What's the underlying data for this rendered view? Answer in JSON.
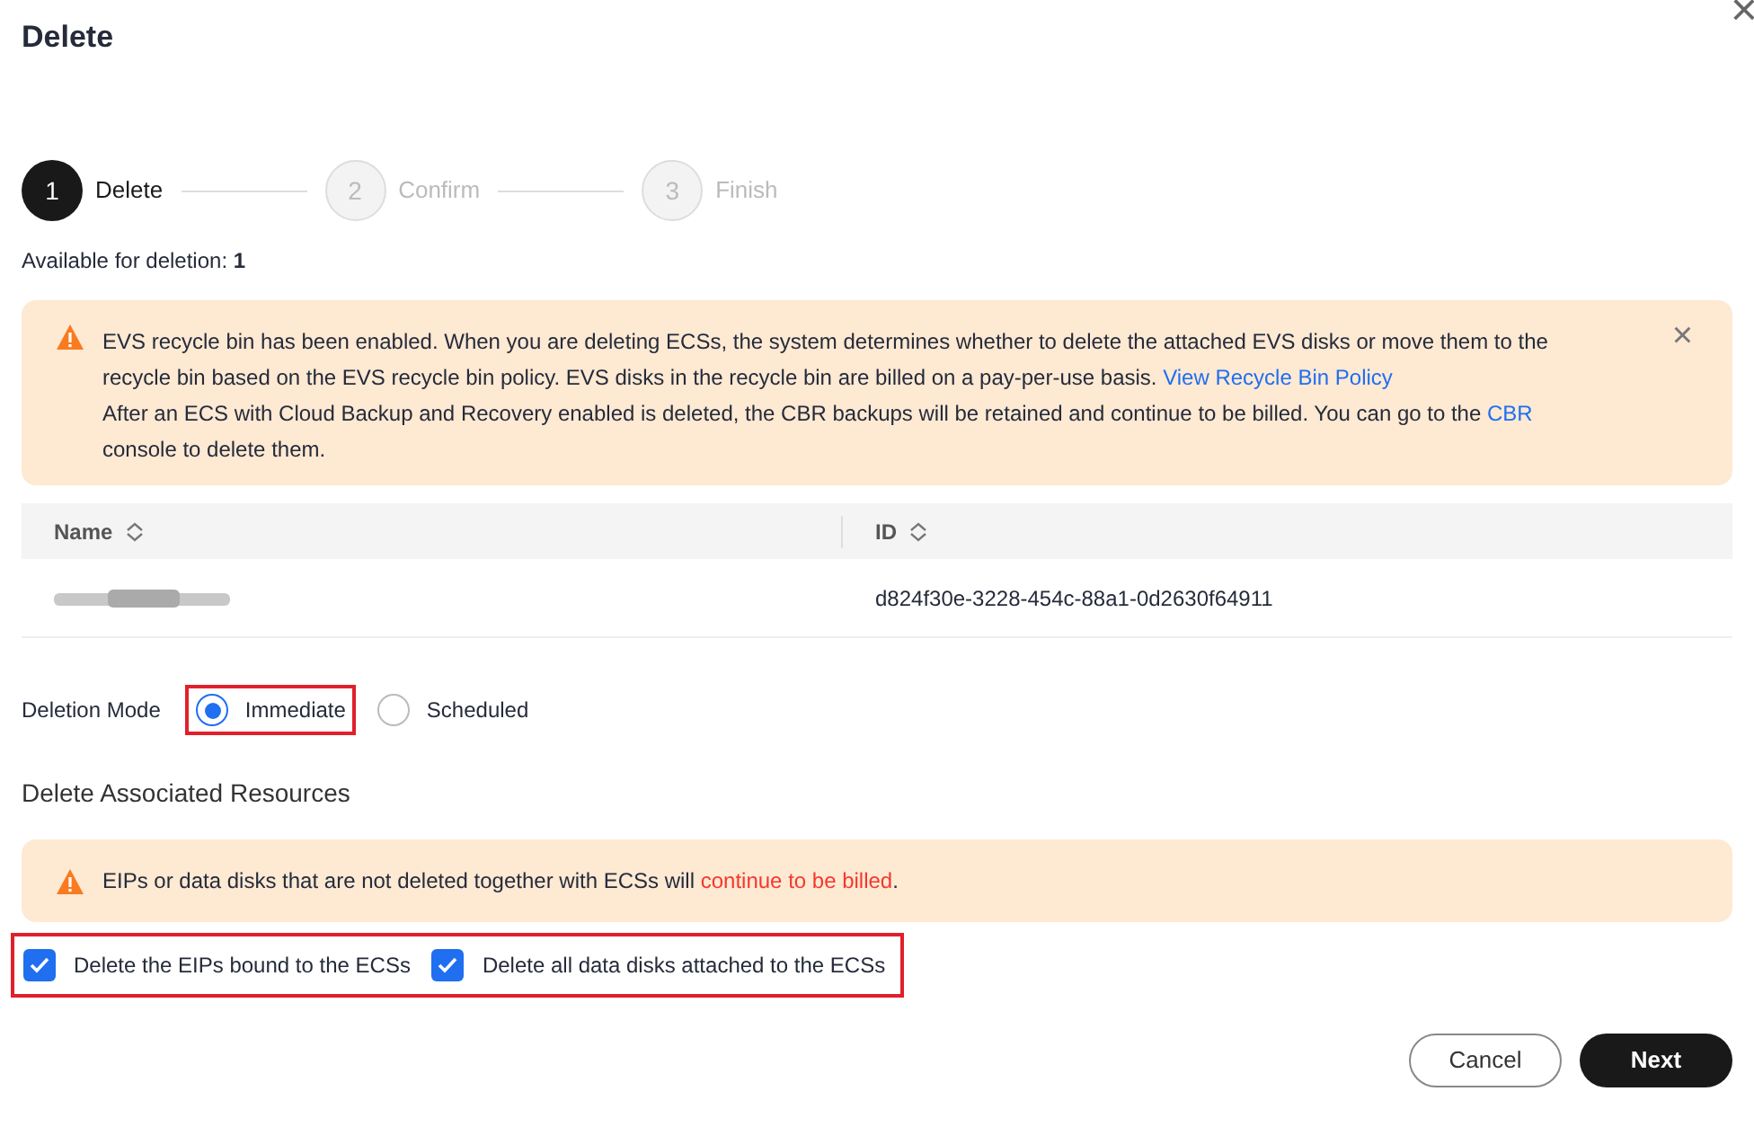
{
  "dialog": {
    "title": "Delete",
    "close": "×"
  },
  "steps": [
    {
      "number": "1",
      "label": "Delete",
      "selected": true
    },
    {
      "number": "2",
      "label": "Confirm",
      "selected": false
    },
    {
      "number": "3",
      "label": "Finish",
      "selected": false
    }
  ],
  "available": {
    "label": "Available for deletion:",
    "count": "1"
  },
  "notice": {
    "dismiss": "×",
    "paragraphs": [
      [
        {
          "text": "EVS recycle bin has been enabled. When you are deleting ECSs, the system determines whether to delete the attached EVS disks or move them to the recycle bin based on the EVS recycle bin policy. EVS disks in the recycle bin are billed on a pay-per-use basis.",
          "kind": "plain"
        },
        {
          "text": "View Recycle Bin Policy",
          "kind": "link"
        }
      ],
      [
        {
          "text": "After an ECS with Cloud Backup and Recovery enabled is deleted, the CBR backups will be retained and continue to be billed. You can go to the",
          "kind": "plain"
        },
        {
          "text": "CBR",
          "kind": "link"
        },
        {
          "text": "console to delete them.",
          "kind": "plain"
        }
      ]
    ]
  },
  "table": {
    "columns": [
      "Name",
      "ID"
    ],
    "rows": [
      {
        "name": {
          "kind": "redacted"
        },
        "id": "d824f30e-3228-454c-88a1-0d2630f64911"
      }
    ]
  },
  "deletion_mode": {
    "label": "Deletion Mode",
    "highlighted": true,
    "options": [
      {
        "label": "Immediate",
        "selected": true
      },
      {
        "label": "Scheduled",
        "selected": false
      }
    ]
  },
  "associated": {
    "title": "Delete Associated Resources",
    "warning": [
      {
        "text": "EIPs or data disks that are not deleted together with ECSs will",
        "kind": "plain"
      },
      {
        "text": "continue to be billed",
        "kind": "danger"
      },
      {
        "text": ".",
        "kind": "tight"
      }
    ],
    "highlighted": true,
    "checkboxes": [
      {
        "label": "Delete the EIPs bound to the ECSs",
        "checked": true
      },
      {
        "label": "Delete all data disks attached to the ECSs",
        "checked": true
      }
    ]
  },
  "buttons": [
    {
      "label": "Cancel",
      "kind": "secondary"
    },
    {
      "label": "Next",
      "kind": "primary"
    }
  ]
}
